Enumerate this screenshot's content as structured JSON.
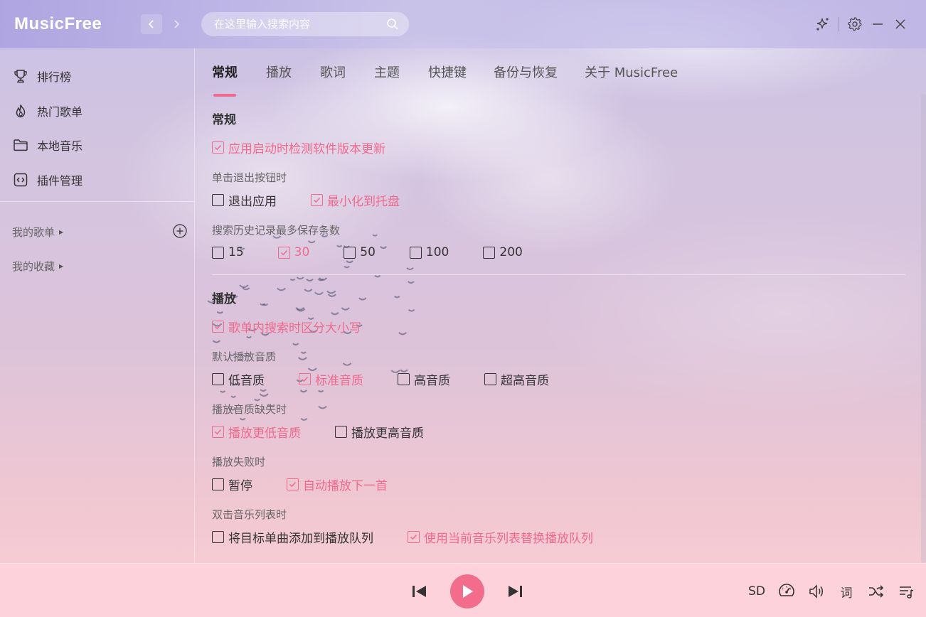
{
  "app": {
    "logo": "MusicFree",
    "search_placeholder": "在这里输入搜索内容"
  },
  "sidebar": {
    "items": [
      {
        "label": "排行榜",
        "icon": "trophy-icon"
      },
      {
        "label": "热门歌单",
        "icon": "fire-icon"
      },
      {
        "label": "本地音乐",
        "icon": "folder-icon"
      },
      {
        "label": "插件管理",
        "icon": "plugin-icon"
      }
    ],
    "groups": [
      {
        "label": "我的歌单"
      },
      {
        "label": "我的收藏"
      }
    ]
  },
  "tabs": [
    {
      "label": "常规",
      "active": true
    },
    {
      "label": "播放"
    },
    {
      "label": "歌词"
    },
    {
      "label": "主题"
    },
    {
      "label": "快捷键"
    },
    {
      "label": "备份与恢复"
    },
    {
      "label": "关于 MusicFree"
    }
  ],
  "settings": {
    "general": {
      "title": "常规",
      "check_update": {
        "label": "应用启动时检测软件版本更新",
        "checked": true
      },
      "exit_behavior": {
        "label": "单击退出按钮时",
        "options": [
          {
            "label": "退出应用",
            "checked": false
          },
          {
            "label": "最小化到托盘",
            "checked": true
          }
        ]
      },
      "search_history": {
        "label": "搜索历史记录最多保存条数",
        "options": [
          {
            "label": "15",
            "checked": false
          },
          {
            "label": "30",
            "checked": true
          },
          {
            "label": "50",
            "checked": false
          },
          {
            "label": "100",
            "checked": false
          },
          {
            "label": "200",
            "checked": false
          }
        ]
      }
    },
    "playback": {
      "title": "播放",
      "case_sensitive": {
        "label": "歌单内搜索时区分大小写",
        "checked": true
      },
      "default_quality": {
        "label": "默认播放音质",
        "options": [
          {
            "label": "低音质",
            "checked": false
          },
          {
            "label": "标准音质",
            "checked": true
          },
          {
            "label": "高音质",
            "checked": false
          },
          {
            "label": "超高音质",
            "checked": false
          }
        ]
      },
      "quality_missing": {
        "label": "播放音质缺失时",
        "options": [
          {
            "label": "播放更低音质",
            "checked": true
          },
          {
            "label": "播放更高音质",
            "checked": false
          }
        ]
      },
      "play_failed": {
        "label": "播放失败时",
        "options": [
          {
            "label": "暂停",
            "checked": false
          },
          {
            "label": "自动播放下一首",
            "checked": true
          }
        ]
      },
      "double_click": {
        "label": "双击音乐列表时",
        "options": [
          {
            "label": "将目标单曲添加到播放队列",
            "checked": false
          },
          {
            "label": "使用当前音乐列表替换播放队列",
            "checked": true
          }
        ]
      }
    }
  },
  "player": {
    "quality_label": "SD",
    "lyric_label": "词"
  },
  "colors": {
    "accent": "#f06a8d",
    "play_button": "#f26c8c"
  }
}
